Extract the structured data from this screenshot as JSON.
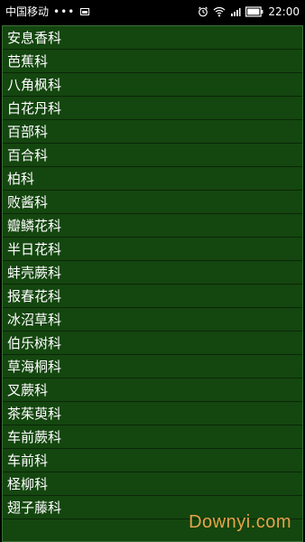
{
  "status_bar": {
    "carrier": "中国移动",
    "dots": "•••",
    "time": "22:00",
    "battery_color": "#ffffff"
  },
  "list": {
    "items": [
      "安息香科",
      "芭蕉科",
      "八角枫科",
      "白花丹科",
      "百部科",
      "百合科",
      "柏科",
      "败酱科",
      "瓣鳞花科",
      "半日花科",
      "蚌壳蕨科",
      "报春花科",
      "冰沼草科",
      "伯乐树科",
      "草海桐科",
      "叉蕨科",
      "茶茱萸科",
      "车前蕨科",
      "车前科",
      "柽柳科",
      "翅子藤科"
    ],
    "background": "#14460f"
  },
  "watermark": {
    "text": "Downyi.com",
    "color": "#e6a34a"
  }
}
